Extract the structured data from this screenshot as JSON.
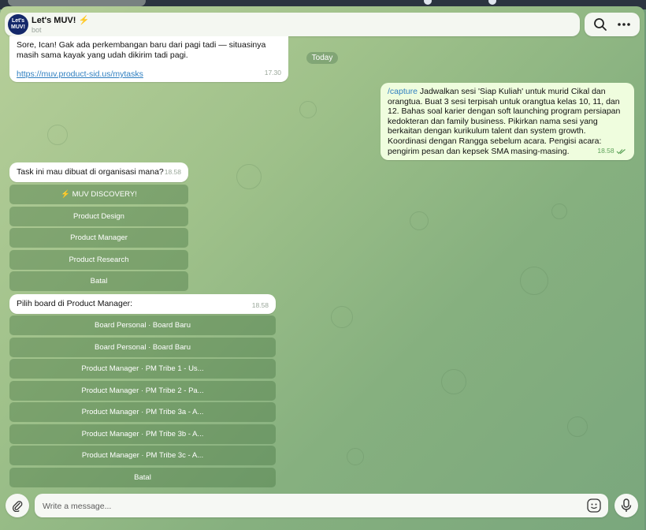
{
  "chat": {
    "title": "Let's MUV!",
    "title_emoji": "⚡",
    "subtitle": "bot",
    "avatar_text": "Let's MUV!"
  },
  "messages": {
    "msg1": {
      "text": "Sore, Ican! Gak ada perkembangan baru dari pagi tadi — situasinya masih sama kayak yang udah dikirim tadi pagi.",
      "link": "https://muv.product-sid.us/mytasks",
      "time": "17.30"
    },
    "date_separator": "Today",
    "msg2": {
      "command": "/capture",
      "text": "Jadwalkan sesi 'Siap Kuliah' untuk murid Cikal dan orangtua. Buat 3 sesi terpisah untuk orangtua kelas 10, 11, dan 12. Bahas soal karier dengan soft launching program persiapan kedokteran dan family business. Pikirkan nama sesi yang berkaitan dengan kurikulum talent dan system growth. Koordinasi dengan Rangga sebelum acara. Pengisi acara: pengirim pesan dan kepsek SMA masing-masing.",
      "time": "18.58"
    },
    "msg3": {
      "text": "Task ini mau dibuat di organisasi mana?",
      "time": "18.58",
      "buttons": [
        "⚡ MUV DISCOVERY!",
        "Product Design",
        "Product Manager",
        "Product Research",
        "Batal"
      ]
    },
    "msg4": {
      "text": "Pilih board di Product Manager:",
      "time": "18.58",
      "buttons": [
        "Board Personal · Board Baru",
        "Board Personal · Board Baru",
        "Product Manager · PM Tribe 1 - Us...",
        "Product Manager · PM Tribe 2 - Pa...",
        "Product Manager · PM Tribe 3a - A...",
        "Product Manager · PM Tribe 3b - A...",
        "Product Manager · PM Tribe 3c - A...",
        "Batal"
      ]
    }
  },
  "composer": {
    "placeholder": "Write a message..."
  },
  "icons": {
    "search": "search-icon",
    "more": "more-vertical-icon",
    "attach": "paperclip-icon",
    "emoji": "sticker-icon",
    "mic": "microphone-icon",
    "read": "double-check-icon"
  },
  "colors": {
    "accent": "#2f7fc0",
    "outgoing_bubble": "#effdde",
    "keyboard_button": "#5a8656"
  }
}
